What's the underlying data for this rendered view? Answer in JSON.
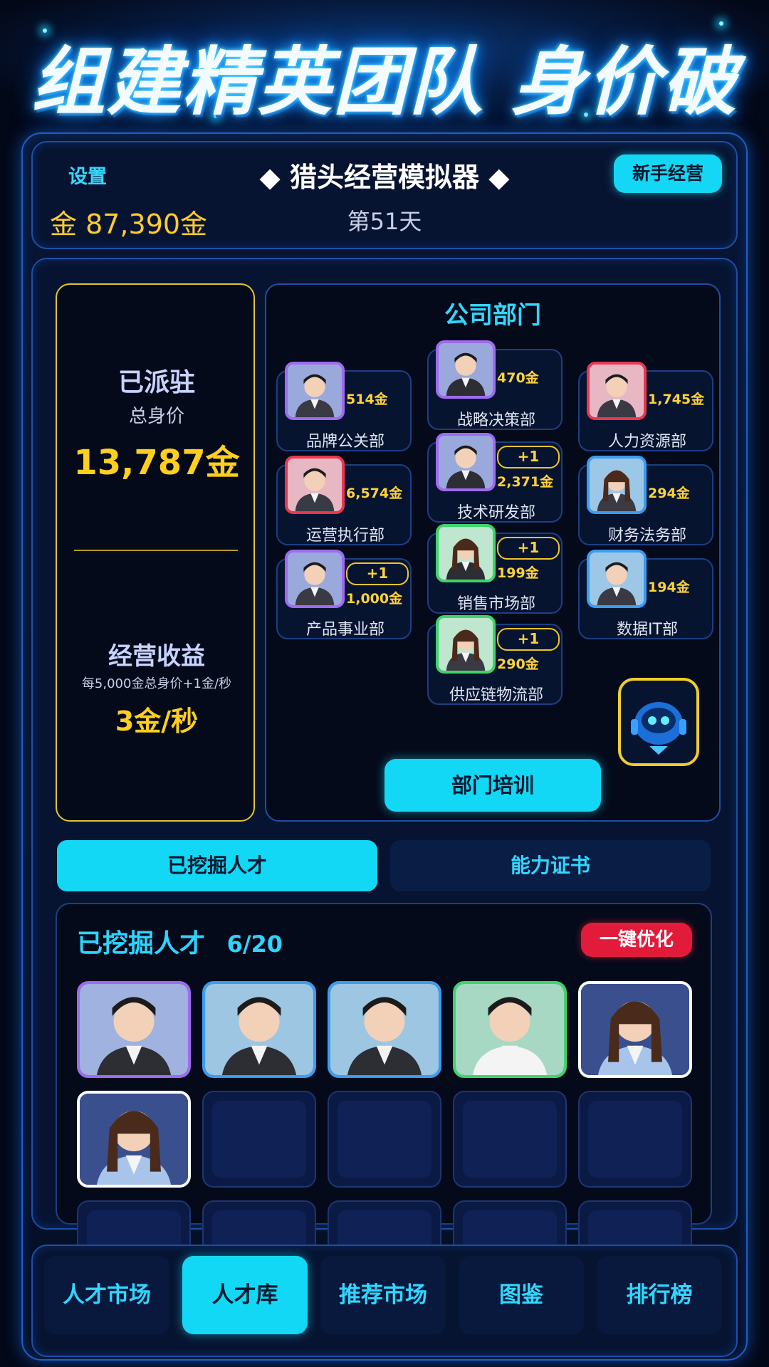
{
  "banner": {
    "title": "组建精英团队 身价破万"
  },
  "header": {
    "settings_label": "设置",
    "game_title": "◆ 猎头经营模拟器 ◆",
    "newbie_button": "新手经营",
    "gold": "金 87,390金",
    "day": "第51天"
  },
  "stats": {
    "deployed_label": "已派驻",
    "total_value_label": "总身价",
    "total_value": "13,787金",
    "income_label": "经营收益",
    "income_rule": "每5,000金总身价+1金/秒",
    "income_rate": "3金/秒"
  },
  "departments": {
    "title": "公司部门",
    "items": [
      {
        "name": "品牌公关部",
        "value": "514金",
        "plus": "",
        "rarity_color": "#a06af0"
      },
      {
        "name": "战略决策部",
        "value": "470金",
        "plus": "",
        "rarity_color": "#a06af0"
      },
      {
        "name": "人力资源部",
        "value": "1,745金",
        "plus": "",
        "rarity_color": "#e8384f"
      },
      {
        "name": "运营执行部",
        "value": "6,574金",
        "plus": "",
        "rarity_color": "#e8384f"
      },
      {
        "name": "技术研发部",
        "value": "2,371金",
        "plus": "+1",
        "rarity_color": "#a06af0"
      },
      {
        "name": "财务法务部",
        "value": "294金",
        "plus": "",
        "rarity_color": "#3b9cf0"
      },
      {
        "name": "产品事业部",
        "value": "1,000金",
        "plus": "+1",
        "rarity_color": "#a06af0"
      },
      {
        "name": "销售市场部",
        "value": "199金",
        "plus": "+1",
        "rarity_color": "#3fd46a"
      },
      {
        "name": "数据IT部",
        "value": "194金",
        "plus": "",
        "rarity_color": "#3b9cf0"
      },
      {
        "name": "供应链物流部",
        "value": "290金",
        "plus": "+1",
        "rarity_color": "#3fd46a"
      }
    ],
    "train_button": "部门培训"
  },
  "tabs": {
    "mined": "已挖掘人才",
    "certificates": "能力证书"
  },
  "talents": {
    "title": "已挖掘人才",
    "count": "6/20",
    "optimize_button": "一键优化",
    "cards": [
      {
        "rarity_color": "#a06af0"
      },
      {
        "rarity_color": "#3b9cf0"
      },
      {
        "rarity_color": "#3b9cf0"
      },
      {
        "rarity_color": "#3fd46a"
      },
      {
        "rarity_color": "#ffffff"
      },
      {
        "rarity_color": "#ffffff"
      }
    ]
  },
  "nav": {
    "items": [
      "人才市场",
      "人才库",
      "推荐市场",
      "图鉴",
      "排行榜"
    ],
    "active": "人才库"
  }
}
